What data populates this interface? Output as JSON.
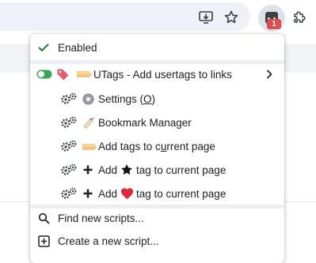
{
  "menu": {
    "enabled_label": "Enabled",
    "script_name": "UTags - Add usertags to links",
    "commands": [
      {
        "label": "Settings (O)",
        "text_before": "Settings (",
        "underlined": "O",
        "text_after": ")"
      },
      {
        "label": "Bookmark Manager"
      },
      {
        "label": "Add tags to current page",
        "text_before": "Add tags to c",
        "underlined": "u",
        "text_after": "rrent page"
      },
      {
        "add": "Add",
        "tag_text": "tag to current page"
      },
      {
        "add": "Add",
        "tag_text": "tag to current page"
      }
    ],
    "find_label": "Find new scripts...",
    "create_label": "Create a new script..."
  },
  "toolbar": {
    "badge_count": "1"
  },
  "icons": {
    "enabled": "checkmark-icon",
    "toggle": "toggle-on-icon",
    "script": "tag-emoji-icon",
    "submenu": "chevron-right-icon",
    "command": "gears-icon",
    "settings": "gear-emoji-icon",
    "bookmark": "bookmark-tag-emoji-icon",
    "tag": "label-emoji-icon",
    "add": "heavy-plus-icon",
    "star": "black-star-icon",
    "heart": "red-heart-icon",
    "find": "search-icon",
    "create": "plus-square-icon"
  },
  "colors": {
    "check": "#188038",
    "toggle": "#34a853",
    "badge": "#e04c4c",
    "heart": "#e0243a",
    "separator": "#eceef1"
  }
}
